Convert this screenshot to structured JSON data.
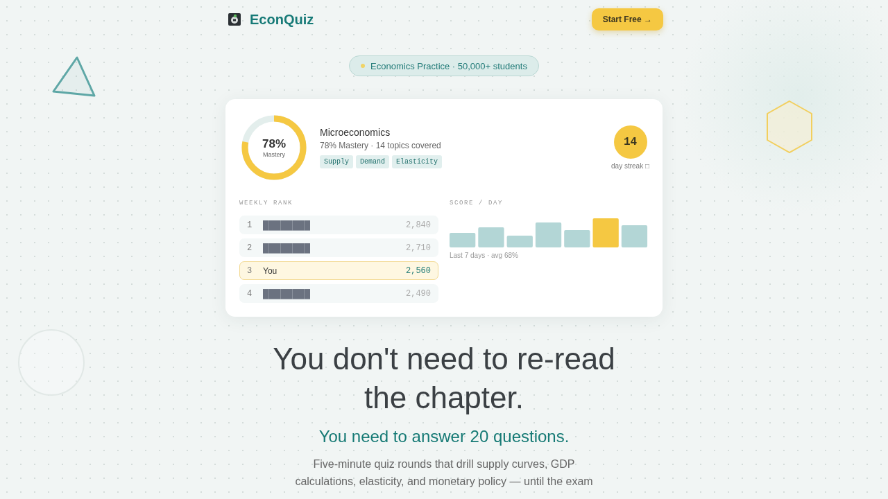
{
  "header": {
    "brand": "EconQuiz",
    "cta": "Start Free →"
  },
  "badge": {
    "text": "Economics Practice · 50,000+ students"
  },
  "card": {
    "mastery": {
      "level": 0.78,
      "value": "78%",
      "label": "Mastery"
    },
    "subject": {
      "title": "Microeconomics",
      "summary": "78% Mastery · 14 topics covered",
      "tags": [
        "Supply",
        "Demand",
        "Elasticity"
      ]
    },
    "streak": {
      "count": "14",
      "label": "day streak □"
    },
    "rank": {
      "title": "WEEKLY RANK",
      "rows": [
        {
          "rank": "1",
          "name": "████████",
          "score": "2,840",
          "highlighted": false
        },
        {
          "rank": "2",
          "name": "████████",
          "score": "2,710",
          "highlighted": false
        },
        {
          "rank": "3",
          "name": "You",
          "score": "2,560",
          "highlighted": true
        },
        {
          "rank": "4",
          "name": "████████",
          "score": "2,490",
          "highlighted": false
        }
      ]
    },
    "score": {
      "title": "SCORE / DAY",
      "caption": "Last 7 days · avg 68%"
    }
  },
  "hero": {
    "headline": "You don't need to re-read the chapter.",
    "subhead": "You need to answer 20 questions.",
    "body": "Five-minute quiz rounds that drill supply curves, GDP calculations, elasticity, and monetary policy — until the exam"
  }
}
